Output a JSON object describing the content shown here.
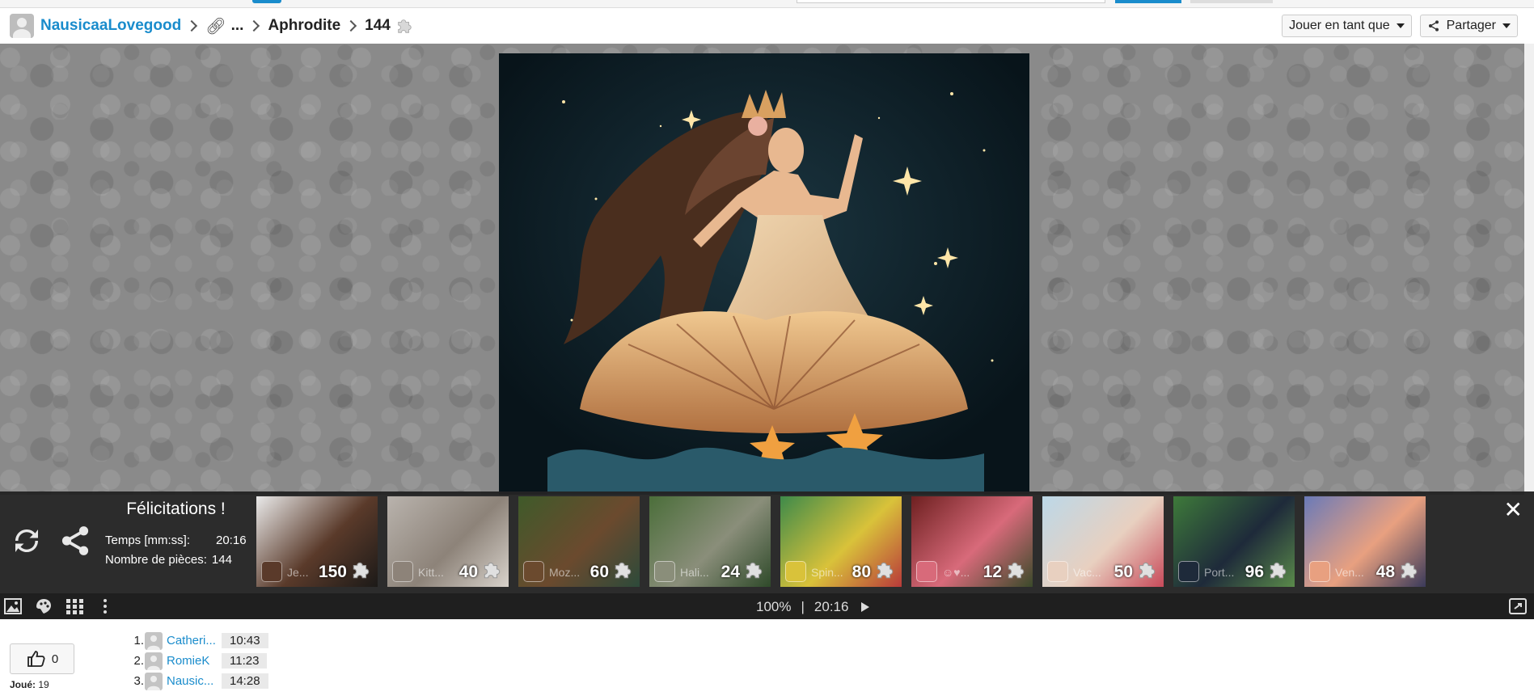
{
  "header": {
    "user": "NausicaaLovegood",
    "link_icon": "link-icon",
    "ellipsis": "...",
    "puzzle_name": "Aphrodite",
    "piece_count": "144",
    "play_as_label": "Jouer en tant que",
    "share_label": "Partager"
  },
  "result": {
    "title": "Félicitations !",
    "time_label": "Temps [mm:ss]:",
    "time_value": "20:16",
    "pieces_label": "Nombre de pièces:",
    "pieces_value": "144"
  },
  "thumbnails": [
    {
      "name": "Je...",
      "count": "150",
      "colors": [
        "#eaeaea",
        "#5a3a2a",
        "#1c1a18"
      ]
    },
    {
      "name": "Kitt...",
      "count": "40",
      "colors": [
        "#b9b3ad",
        "#8d8379",
        "#d8d2cb"
      ]
    },
    {
      "name": "Moz...",
      "count": "60",
      "colors": [
        "#3f5a2a",
        "#6b4a2e",
        "#2d4a3a"
      ]
    },
    {
      "name": "Hali...",
      "count": "24",
      "colors": [
        "#4b6e3a",
        "#8a8e7a",
        "#2f4a2a"
      ]
    },
    {
      "name": "Spin...",
      "count": "80",
      "colors": [
        "#3e8a4a",
        "#d9c23a",
        "#b83a3a"
      ]
    },
    {
      "name": "☺♥...",
      "count": "12",
      "colors": [
        "#6e2020",
        "#d86a7a",
        "#3a4a2a"
      ]
    },
    {
      "name": "Vac...",
      "count": "50",
      "colors": [
        "#bcd8e8",
        "#e8d0c0",
        "#c84a5a"
      ]
    },
    {
      "name": "Port...",
      "count": "96",
      "colors": [
        "#3e7a3a",
        "#1e2a3a",
        "#5a8a4a"
      ]
    },
    {
      "name": "Ven...",
      "count": "48",
      "colors": [
        "#6a7ab8",
        "#e8a080",
        "#3a3a5a"
      ]
    }
  ],
  "toolbar": {
    "zoom": "100%",
    "separator": "|",
    "timer": "20:16"
  },
  "footer": {
    "likes": "0",
    "played_label": "Joué:",
    "played_count": "19",
    "leaderboard": [
      {
        "rank": "1.",
        "name": "Catheri...",
        "time": "10:43"
      },
      {
        "rank": "2.",
        "name": "RomieK",
        "time": "11:23"
      },
      {
        "rank": "3.",
        "name": "Nausic...",
        "time": "14:28"
      }
    ]
  }
}
